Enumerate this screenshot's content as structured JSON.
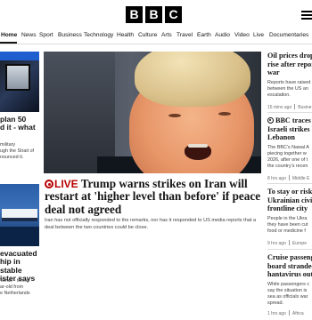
{
  "brand": {
    "letters": [
      "B",
      "B",
      "C"
    ]
  },
  "nav": {
    "items": [
      "Home",
      "News",
      "Sport",
      "Business",
      "Technology",
      "Health",
      "Culture",
      "Arts",
      "Travel",
      "Earth",
      "Audio",
      "Video",
      "Live",
      "Documentaries"
    ],
    "active": "Home"
  },
  "left": {
    "story1": {
      "title_lines": [
        "plan 50",
        "d it - what"
      ],
      "summary_lines": [
        "military",
        "ugh the Strait of",
        "nounced it."
      ]
    },
    "story2": {
      "title_lines": [
        "evacuated",
        "hip in stable",
        "ister says"
      ],
      "summary_lines": [
        "Verde - three",
        "ar-old from",
        "e Netherlands"
      ]
    }
  },
  "main": {
    "live_label": "LIVE",
    "headline": "Trump warns strikes on Iran will restart at 'higher level than before' if peace deal not agreed",
    "summary": "Iran has not officially responded to the remarks, nor has it responded to US media reports that a deal between the two countries could be close."
  },
  "right": {
    "story1": {
      "title_lines": [
        "Oil prices drop",
        "rise after repor",
        "war"
      ],
      "summary_lines": [
        "Reports have raised",
        "between the US an",
        "escalation."
      ],
      "time": "15 mins ago",
      "section": "Busine"
    },
    "story2": {
      "title_lines": [
        "BBC traces",
        "Israeli strikes b",
        "Lebanon"
      ],
      "summary_lines": [
        "The BBC's Nawal A",
        "piecing together w",
        "2026, after one of t",
        "the country's recen"
      ],
      "time": "8 hrs ago",
      "section": "Middle E"
    },
    "story3": {
      "title_lines": [
        "To stay or risk",
        "Ukrainian civil",
        "frontline city"
      ],
      "summary_lines": [
        "People in the Ukra",
        "they have been cut",
        "food or medicine f"
      ],
      "time": "9 hrs ago",
      "section": "Europe"
    },
    "story4": {
      "title_lines": [
        "Cruise passeng",
        "board stranded",
        "hantavirus out"
      ],
      "summary_lines": [
        "While passengers c",
        "say the situation is",
        "sea as officials war",
        "spread."
      ],
      "time": "1 hrs ago",
      "section": "Africa"
    }
  }
}
